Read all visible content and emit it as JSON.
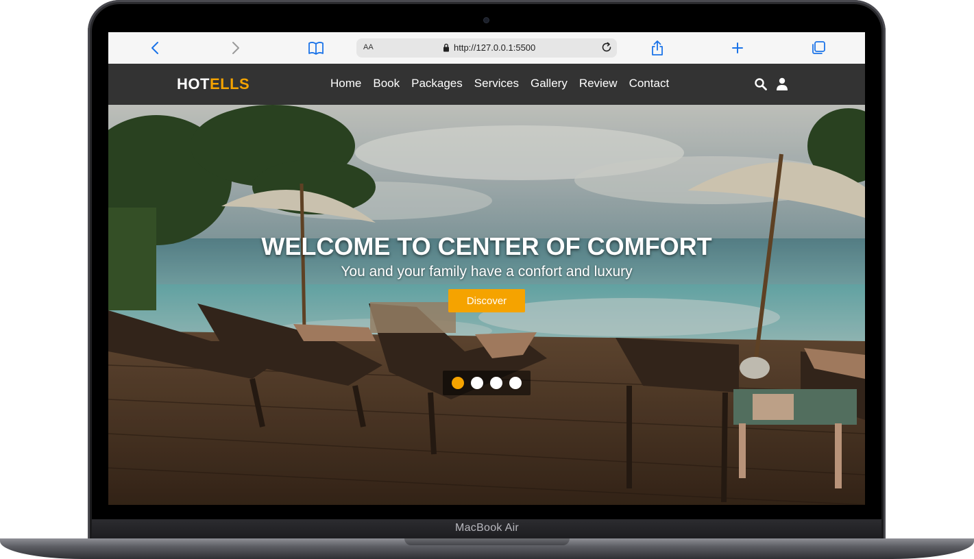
{
  "device": {
    "model_label": "MacBook Air"
  },
  "browser": {
    "text_size_label": "AA",
    "url": "http://127.0.0.1:5500",
    "icons": [
      "back-icon",
      "forward-icon",
      "bookmarks-icon",
      "lock-icon",
      "reload-icon",
      "share-icon",
      "new-tab-icon",
      "tabs-icon"
    ],
    "accent": "#1a73e8"
  },
  "site": {
    "logo": {
      "part1": "HOT",
      "part2": "ELLS"
    },
    "nav": [
      "Home",
      "Book",
      "Packages",
      "Services",
      "Gallery",
      "Review",
      "Contact"
    ],
    "nav_icons": [
      "search-icon",
      "user-icon"
    ],
    "colors": {
      "accent": "#f5a300",
      "navbar": "#333333"
    }
  },
  "hero": {
    "title": "WELCOME TO CENTER OF COMFORT",
    "subtitle": "You and your family have a confort and luxury",
    "button_label": "Discover",
    "slider": {
      "count": 4,
      "active_index": 0
    }
  }
}
